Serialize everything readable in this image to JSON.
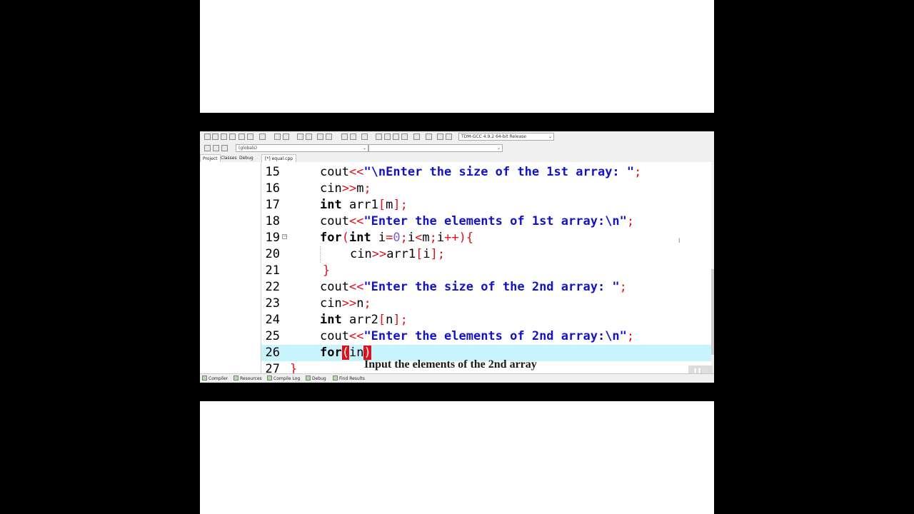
{
  "toolbar": {
    "icons": [
      "new-file",
      "open",
      "save",
      "save-all",
      "close",
      "close-all",
      "print",
      "undo",
      "redo",
      "find",
      "replace",
      "find-next",
      "goto",
      "indent",
      "unindent",
      "bookmark",
      "toggle-comment",
      "compile",
      "run",
      "compile-run",
      "rebuild",
      "check",
      "stop",
      "debug",
      "chart",
      "profile"
    ],
    "compiler": "TDM-GCC 4.9.2 64-bit Release"
  },
  "scope": {
    "value": "(globals)"
  },
  "panel_tabs": [
    "Project",
    "Classes",
    "Debug"
  ],
  "file_tab": "[*] equal.cpp",
  "code_lines": [
    {
      "num": "15",
      "fold": false,
      "current": false
    },
    {
      "num": "16",
      "fold": false,
      "current": false
    },
    {
      "num": "17",
      "fold": false,
      "current": false
    },
    {
      "num": "18",
      "fold": false,
      "current": false
    },
    {
      "num": "19",
      "fold": true,
      "current": false
    },
    {
      "num": "20",
      "fold": false,
      "current": false
    },
    {
      "num": "21",
      "fold": false,
      "current": false
    },
    {
      "num": "22",
      "fold": false,
      "current": false
    },
    {
      "num": "23",
      "fold": false,
      "current": false
    },
    {
      "num": "24",
      "fold": false,
      "current": false
    },
    {
      "num": "25",
      "fold": false,
      "current": false
    },
    {
      "num": "26",
      "fold": false,
      "current": true
    },
    {
      "num": "27",
      "fold": false,
      "current": false
    }
  ],
  "code": {
    "l15": {
      "a": "cout",
      "b": "<<",
      "c": "\"\\nEnter the size of the 1st array: \"",
      "d": ";"
    },
    "l16": {
      "a": "cin",
      "b": ">>",
      "c": "m",
      "d": ";"
    },
    "l17": {
      "a": "int",
      "b": " arr1",
      "c": "[",
      "d": "m",
      "e": "];"
    },
    "l18": {
      "a": "cout",
      "b": "<<",
      "c": "\"Enter the elements of 1st array:\\n\"",
      "d": ";"
    },
    "l19": {
      "a": "for",
      "b": "(",
      "c": "int",
      "d": " i",
      "e": "=",
      "f": "0",
      "g": ";",
      "h": "i",
      "i": "<",
      "j": "m",
      "k": ";",
      "l": "i",
      "m": "++){"
    },
    "l20": {
      "a": "cin",
      "b": ">>",
      "c": "arr1",
      "d": "[",
      "e": "i",
      "f": "];"
    },
    "l21": {
      "a": "}"
    },
    "l22": {
      "a": "cout",
      "b": "<<",
      "c": "\"Enter the size of the 2nd array: \"",
      "d": ";"
    },
    "l23": {
      "a": "cin",
      "b": ">>",
      "c": "n",
      "d": ";"
    },
    "l24": {
      "a": "int",
      "b": " arr2",
      "c": "[",
      "d": "n",
      "e": "];"
    },
    "l25": {
      "a": "cout",
      "b": "<<",
      "c": "\"Enter the elements of 2nd array:\\n\"",
      "d": ";"
    },
    "l26": {
      "a": "for",
      "b": "(",
      "c": "in",
      "d": ")"
    },
    "l27": {
      "a": "}"
    }
  },
  "caption": "Input the elements of the 2nd array",
  "statusbar": [
    "Compiler",
    "Resources",
    "Compile Log",
    "Debug",
    "Find Results"
  ],
  "colors": {
    "keyword": "#000000",
    "operator": "#e0101a",
    "string": "#1212c8",
    "current_line": "#c8f4fd"
  }
}
